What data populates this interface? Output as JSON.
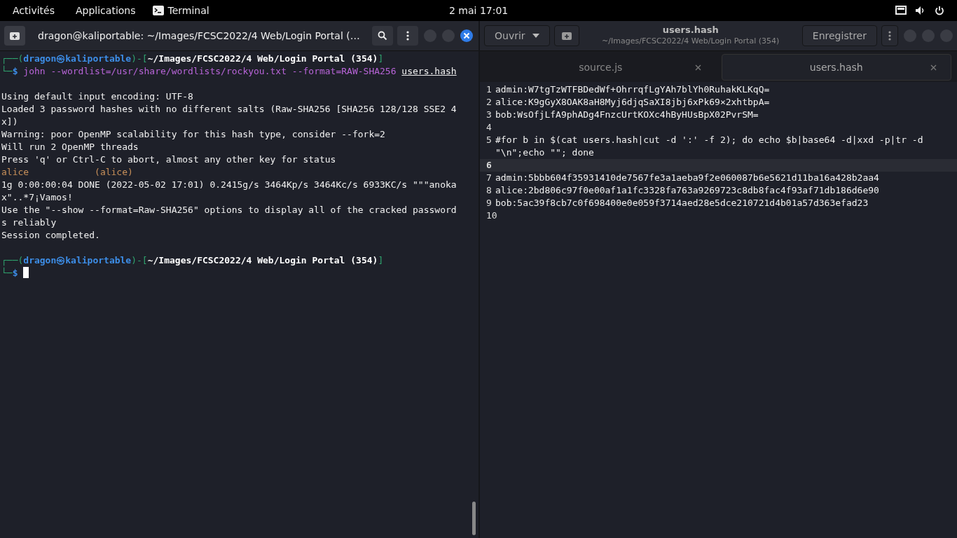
{
  "top_bar": {
    "activities": "Activités",
    "applications": "Applications",
    "app_name": "Terminal",
    "clock": "2 mai  17:01"
  },
  "terminal": {
    "title": "dragon@kaliportable: ~/Images/FCSC2022/4 Web/Login Portal (…",
    "lines": [
      {
        "kind": "prompt",
        "open": "┌──(",
        "user": "dragon㉿kaliportable",
        "mid": ")-[",
        "path": "~/Images/FCSC2022/4 Web/Login Portal (354)",
        "close": "]"
      },
      {
        "kind": "command",
        "prefix": "└─",
        "dollar": "$",
        "command": "john --wordlist=/usr/share/wordlists/rockyou.txt --format=RAW-SHA256",
        "argument": "users.hash"
      },
      {
        "kind": "blank"
      },
      {
        "kind": "text",
        "text": "Using default input encoding: UTF-8"
      },
      {
        "kind": "text",
        "text": "Loaded 3 password hashes with no different salts (Raw-SHA256 [SHA256 128/128 SSE2 4"
      },
      {
        "kind": "text",
        "text": "x])"
      },
      {
        "kind": "text",
        "text": "Warning: poor OpenMP scalability for this hash type, consider --fork=2"
      },
      {
        "kind": "text",
        "text": "Will run 2 OpenMP threads"
      },
      {
        "kind": "text",
        "text": "Press 'q' or Ctrl-C to abort, almost any other key for status"
      },
      {
        "kind": "found",
        "text": "alice            (alice)"
      },
      {
        "kind": "text",
        "text": "1g 0:00:00:04 DONE (2022-05-02 17:01) 0.2415g/s 3464Kp/s 3464Kc/s 6933KC/s \"\"\"anoka"
      },
      {
        "kind": "text",
        "text": "x\"..*7¡Vamos!"
      },
      {
        "kind": "text",
        "text": "Use the \"--show --format=Raw-SHA256\" options to display all of the cracked password"
      },
      {
        "kind": "text",
        "text": "s reliably"
      },
      {
        "kind": "text",
        "text": "Session completed."
      },
      {
        "kind": "blank"
      },
      {
        "kind": "prompt",
        "open": "┌──(",
        "user": "dragon㉿kaliportable",
        "mid": ")-[",
        "path": "~/Images/FCSC2022/4 Web/Login Portal (354)",
        "close": "]"
      },
      {
        "kind": "cursor",
        "prefix": "└─",
        "dollar": "$"
      }
    ]
  },
  "editor": {
    "open_button": "Ouvrir",
    "title": "users.hash",
    "subtitle": "~/Images/FCSC2022/4 Web/Login Portal (354)",
    "save_button": "Enregistrer",
    "tabs": [
      {
        "label": "source.js",
        "selected": false
      },
      {
        "label": "users.hash",
        "selected": true
      }
    ],
    "lines": [
      {
        "number": "1",
        "text": "admin:W7tgTzWTFBDedWf+OhrrqfLgYAh7blYh0RuhakKLKqQ=",
        "current": false
      },
      {
        "number": "2",
        "text": "alice:K9gGyX8OAK8aH8Myj6djqSaXI8jbj6xPk69×2xhtbpA=",
        "current": false
      },
      {
        "number": "3",
        "text": "bob:WsOfjLfA9phADg4FnzcUrtKOXc4hByHUsBpX02PvrSM=",
        "current": false
      },
      {
        "number": "4",
        "current": false
      },
      {
        "number": "5",
        "text": "#for b in $(cat users.hash|cut -d ':' -f 2); do echo $b|base64 -d|xxd -p|tr -d \"\\n\";echo \"\"; done",
        "current": false
      },
      {
        "number": "6",
        "current": true
      },
      {
        "number": "7",
        "text": "admin:5bbb604f35931410de7567fe3a1aeba9f2e060087b6e5621d11ba16a428b2aa4",
        "current": false
      },
      {
        "number": "8",
        "text": "alice:2bd806c97f0e00af1a1fc3328fa763a9269723c8db8fac4f93af71db186d6e90",
        "current": false
      },
      {
        "number": "9",
        "text": "bob:5ac39f8cb7c0f698400e0e059f3714aed28e5dce210721d4b01a57d363efad23",
        "current": false
      },
      {
        "number": "10",
        "current": false
      }
    ]
  }
}
